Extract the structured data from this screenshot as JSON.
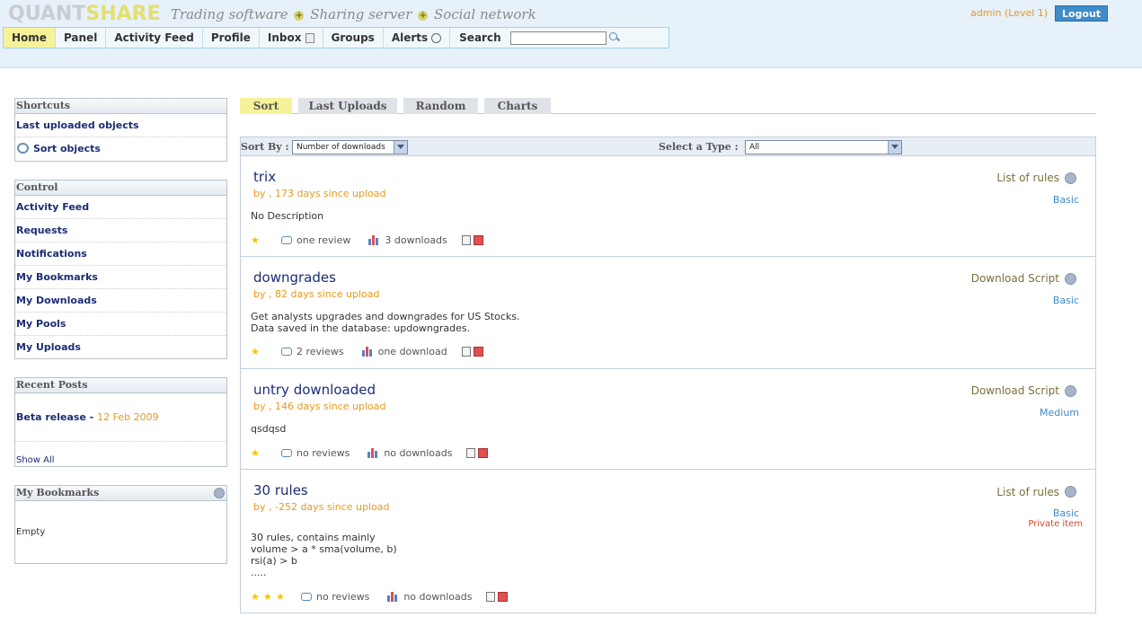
{
  "header": {
    "logo_left": "QUANT",
    "logo_right": "SHARE",
    "tagline": [
      "Trading software",
      "Sharing server",
      "Social network"
    ],
    "user_label": "admin (Level 1)",
    "logout_label": "Logout"
  },
  "nav": {
    "items": [
      "Home",
      "Panel",
      "Activity Feed",
      "Profile",
      "Inbox",
      "Groups",
      "Alerts"
    ],
    "active": "Home",
    "search_label": "Search",
    "search_value": ""
  },
  "shortcuts": {
    "title": "Shortcuts",
    "items": [
      "Last uploaded objects",
      "Sort objects"
    ]
  },
  "control": {
    "title": "Control",
    "items": [
      "Activity Feed",
      "Requests",
      "Notifications",
      "My Bookmarks",
      "My Downloads",
      "My Pools",
      "My Uploads"
    ]
  },
  "recent_posts": {
    "title": "Recent Posts",
    "post_title": "Beta release",
    "post_sep": " - ",
    "post_date": "12 Feb 2009",
    "show_all": "Show All"
  },
  "bookmarks": {
    "title": "My Bookmarks",
    "empty": "Empty"
  },
  "tabs": [
    "Sort",
    "Last Uploads",
    "Random",
    "Charts"
  ],
  "sortbar": {
    "sort_label": "Sort By :",
    "sort_value": "Number of downloads",
    "type_label": "Select a Type :",
    "type_value": "All"
  },
  "items": [
    {
      "title": "trix",
      "sub": "by , 173 days since upload",
      "desc": "No Description",
      "type": "List of rules",
      "level": "Basic",
      "reviews": "one review",
      "downloads": "3 downloads",
      "stars": 1
    },
    {
      "title": "downgrades",
      "sub": "by , 82 days since upload",
      "desc": "Get analysts upgrades and downgrades for US Stocks.\nData saved in the database: updowngrades.",
      "type": "Download Script",
      "level": "Basic",
      "reviews": "2 reviews",
      "downloads": "one download",
      "stars": 1
    },
    {
      "title": "untry downloaded",
      "sub": "by , 146 days since upload",
      "desc": "qsdqsd",
      "type": "Download Script",
      "level": "Medium",
      "reviews": "no reviews",
      "downloads": "no downloads",
      "stars": 1
    },
    {
      "title": "30 rules",
      "sub": "by , -252 days since upload",
      "desc": "30 rules, contains mainly\nvolume > a * sma(volume, b)\nrsi(a) > b\n.....",
      "type": "List of rules",
      "level": "Basic",
      "private": "Private item",
      "reviews": "no reviews",
      "downloads": "no downloads",
      "stars": 3
    }
  ],
  "colors": {
    "header_bg": "#e6f1fa",
    "link_navy": "#1c2d74",
    "accent_orange": "#e59a1d",
    "level_blue": "#3f8cc9",
    "active_tab": "#f6f29a",
    "private_red": "#d9452b"
  }
}
